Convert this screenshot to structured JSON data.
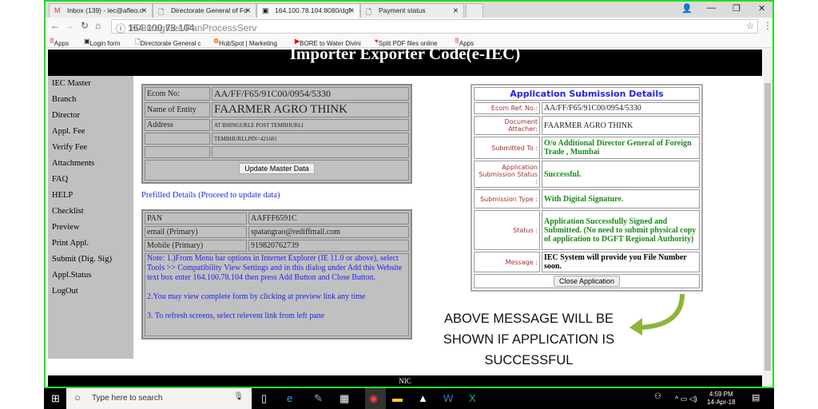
{
  "browser": {
    "tabs": [
      {
        "label": "Inbox (139) - iec@afleo.c",
        "icon": "gmail-icon"
      },
      {
        "label": "Directorate General of Fo",
        "icon": "page-icon"
      },
      {
        "label": "164.100.78.104:8080/dgf",
        "icon": "image-icon",
        "active": true
      },
      {
        "label": "Payment status",
        "icon": "page-icon"
      }
    ],
    "url_host": "164.100.78.104",
    "url_rest": ":8080/dgftiec/PanProcessServ",
    "bookmarks": [
      "Apps",
      "Login form",
      "Directorate General c",
      "HubSpot | Marketing",
      "BORE to Water Divini",
      "Split PDF files online",
      "Apps"
    ]
  },
  "page": {
    "header_title": "Importer Exporter Code(e-IEC)",
    "sidebar": [
      "IEC Master",
      "Branch",
      "Director",
      "Appl. Fee",
      "Verify Fee",
      "Attachments",
      "FAQ",
      "HELP",
      "Checklist",
      "Preview",
      "Print Appl.",
      "Submit (Dig. Sig)",
      "Appl.Status",
      "LogOut"
    ],
    "master": {
      "ecom_label": "Ecom No:",
      "ecom_value": "AA/FF/F65/91C00/0954/5330",
      "entity_label": "Name of Entity",
      "entity_value": "FAARMER AGRO THINK",
      "address_label": "Address",
      "address_line1": "AT BHINGURLE POST TEMBHURLI",
      "address_line2": "TEMBHURLI,PIN=421601",
      "update_button": "Update Master Data"
    },
    "prefilled_link": "Prefilled Details (Proceed to update data)",
    "prefilled": {
      "rows": [
        [
          "PAN",
          "AAFFF6591C"
        ],
        [
          "email (Primary)",
          "spatangrao@rediffmail.com"
        ],
        [
          "Mobile (Primary)",
          "919820762739"
        ]
      ],
      "note1": "Note: 1.)From Menu bar options in Internet Explorer (IE 11.0 or above), select Tools >> Compatibility View Settings and in this dialog under Add this Website text box enter 164.100.78.104 then press Add Button and Close Button.",
      "note2": "2.You may view complete form by clicking at preview link any time",
      "note3": "3. To refresh screens, select relevent link from left pane"
    },
    "submission": {
      "title": "Application Submission Details",
      "rows": [
        {
          "label": "Ecom Ref. No.:",
          "value": "AA/FF/F65/91C00/0954/5330"
        },
        {
          "label": "Document Attacher:",
          "value": "FAARMER AGRO THINK"
        },
        {
          "label": "Submitted To :",
          "value": "O/o Additional Director General of Foreign Trade  , Mumbai"
        },
        {
          "label": "Application Submission Status :",
          "value": "Successful."
        },
        {
          "label": "Submission Type :",
          "value": "With Digital Signature."
        },
        {
          "label": "Status :",
          "value": "Application Successfully Signed and Submitted. (No need to submit physical copy of application to DGFT Regional Authority)"
        },
        {
          "label": "Message :",
          "value": "IEC System will provide you File Number soon."
        }
      ],
      "close_button": "Close Application"
    },
    "annotation": [
      "ABOVE MESSAGE WILL BE",
      "SHOWN IF APPLICATION IS",
      "SUCCESSFUL"
    ],
    "footer": "NIC"
  },
  "taskbar": {
    "search_placeholder": "Type here to search",
    "time": "4:59 PM",
    "date": "14-Apr-18"
  },
  "colors": {
    "window_border": "#22dd22",
    "success_text": "#1a8a1a",
    "label_text": "#a03030",
    "link_text": "#2222ee",
    "arrow": "#8db53a"
  }
}
